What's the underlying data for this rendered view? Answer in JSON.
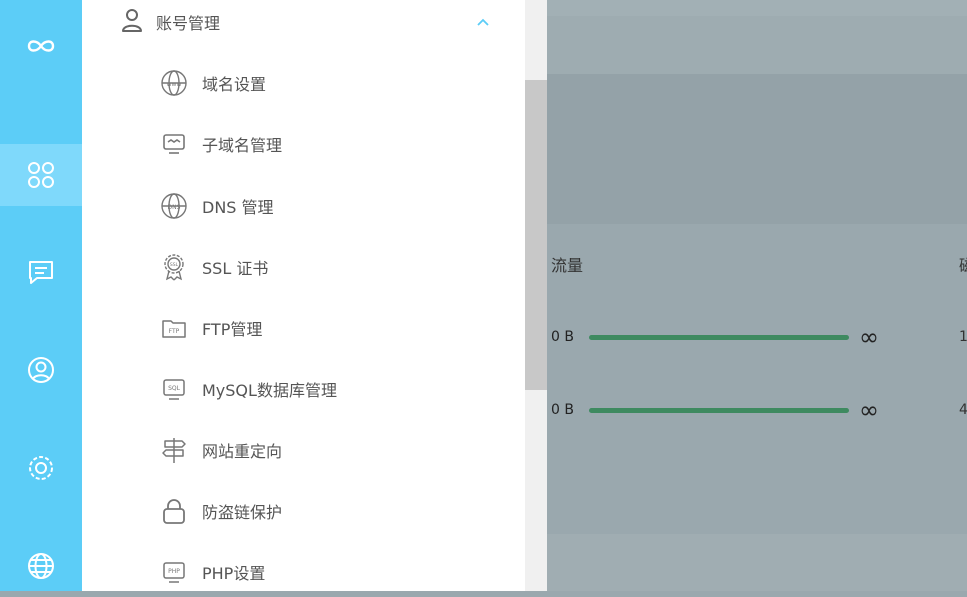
{
  "rail": {
    "items": [
      {
        "icon": "infinity-logo-icon"
      },
      {
        "icon": "apps-grid-icon",
        "active": true
      },
      {
        "icon": "message-icon"
      },
      {
        "icon": "user-circle-icon"
      },
      {
        "icon": "settings-gear-icon"
      },
      {
        "icon": "globe-icon"
      }
    ]
  },
  "submenu": {
    "header": {
      "label": "账号管理",
      "icon": "user-icon",
      "chevron": "chevron-up-icon"
    },
    "items": [
      {
        "label": "域名设置",
        "icon": "www-globe-icon"
      },
      {
        "label": "子域名管理",
        "icon": "subdomain-monitor-icon"
      },
      {
        "label": "DNS 管理",
        "icon": "dns-globe-icon"
      },
      {
        "label": "SSL 证书",
        "icon": "ssl-badge-icon"
      },
      {
        "label": "FTP管理",
        "icon": "ftp-folder-icon"
      },
      {
        "label": "MySQL数据库管理",
        "icon": "sql-monitor-icon"
      },
      {
        "label": "网站重定向",
        "icon": "signpost-icon"
      },
      {
        "label": "防盗链保护",
        "icon": "lock-icon"
      },
      {
        "label": "PHP设置",
        "icon": "php-monitor-icon"
      }
    ]
  },
  "content": {
    "column_header": "流量",
    "column_header_2": "磁",
    "rows": [
      {
        "value": "0 B",
        "limit": "∞",
        "edge": "1"
      },
      {
        "value": "0 B",
        "limit": "∞",
        "edge": "4"
      }
    ]
  },
  "colors": {
    "rail": "#5ccdf7",
    "rail_active": "#7fd9fb",
    "overlay": "#9aa8ae",
    "bar": "#3e8a60",
    "chevron": "#5ccdf7"
  }
}
